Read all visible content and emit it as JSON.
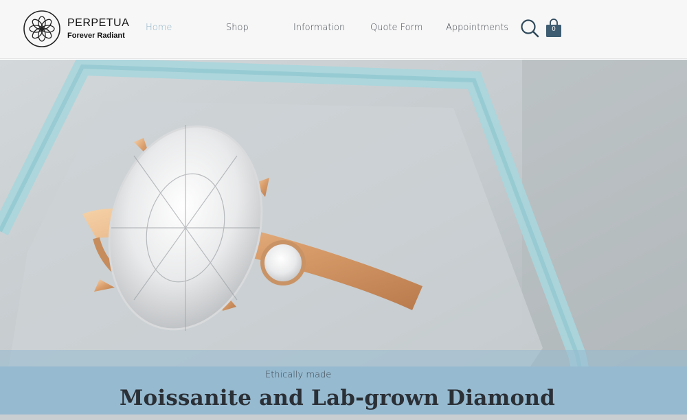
{
  "brand": {
    "name": "PERPETUA",
    "tagline": "Forever Radiant"
  },
  "nav": {
    "items": [
      {
        "label": "Home",
        "active": true
      },
      {
        "label": "Shop",
        "active": false
      },
      {
        "label": "Information",
        "active": false
      },
      {
        "label": "Quote Form",
        "active": false
      },
      {
        "label": "Appointments",
        "active": false
      }
    ],
    "search_icon": "search-icon",
    "cart_icon": "shopping-bag-icon",
    "cart_count": "0"
  },
  "hero": {
    "image": "rose-gold-oval-diamond-ring-in-blue-velvet-box",
    "kicker": "Ethically made",
    "headline": "Moissanite and Lab-grown Diamond"
  },
  "colors": {
    "accent": "#8ab0c6",
    "band": "#96bad0",
    "icon": "#2f4a5c",
    "text": "#2b3036"
  }
}
